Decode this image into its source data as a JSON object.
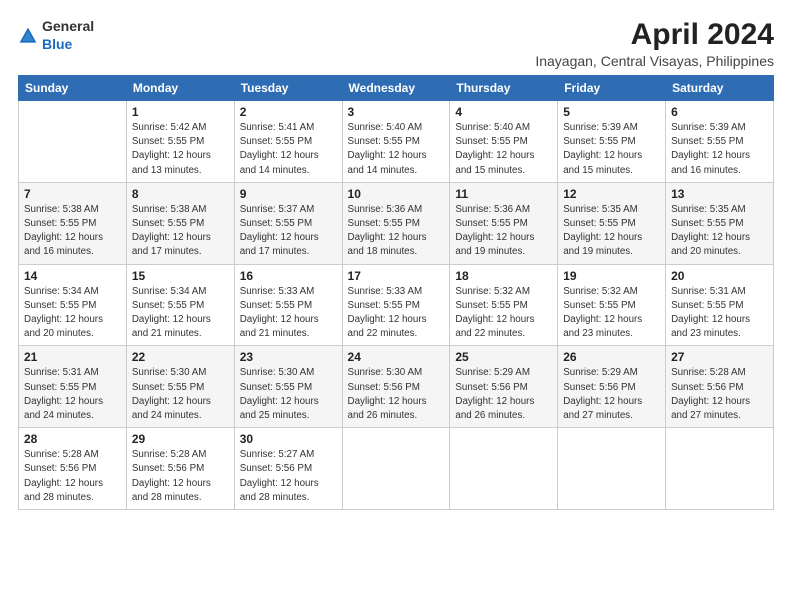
{
  "logo": {
    "general": "General",
    "blue": "Blue"
  },
  "header": {
    "title": "April 2024",
    "subtitle": "Inayagan, Central Visayas, Philippines"
  },
  "columns": [
    "Sunday",
    "Monday",
    "Tuesday",
    "Wednesday",
    "Thursday",
    "Friday",
    "Saturday"
  ],
  "weeks": [
    [
      {
        "day": "",
        "info": ""
      },
      {
        "day": "1",
        "info": "Sunrise: 5:42 AM\nSunset: 5:55 PM\nDaylight: 12 hours\nand 13 minutes."
      },
      {
        "day": "2",
        "info": "Sunrise: 5:41 AM\nSunset: 5:55 PM\nDaylight: 12 hours\nand 14 minutes."
      },
      {
        "day": "3",
        "info": "Sunrise: 5:40 AM\nSunset: 5:55 PM\nDaylight: 12 hours\nand 14 minutes."
      },
      {
        "day": "4",
        "info": "Sunrise: 5:40 AM\nSunset: 5:55 PM\nDaylight: 12 hours\nand 15 minutes."
      },
      {
        "day": "5",
        "info": "Sunrise: 5:39 AM\nSunset: 5:55 PM\nDaylight: 12 hours\nand 15 minutes."
      },
      {
        "day": "6",
        "info": "Sunrise: 5:39 AM\nSunset: 5:55 PM\nDaylight: 12 hours\nand 16 minutes."
      }
    ],
    [
      {
        "day": "7",
        "info": "Sunrise: 5:38 AM\nSunset: 5:55 PM\nDaylight: 12 hours\nand 16 minutes."
      },
      {
        "day": "8",
        "info": "Sunrise: 5:38 AM\nSunset: 5:55 PM\nDaylight: 12 hours\nand 17 minutes."
      },
      {
        "day": "9",
        "info": "Sunrise: 5:37 AM\nSunset: 5:55 PM\nDaylight: 12 hours\nand 17 minutes."
      },
      {
        "day": "10",
        "info": "Sunrise: 5:36 AM\nSunset: 5:55 PM\nDaylight: 12 hours\nand 18 minutes."
      },
      {
        "day": "11",
        "info": "Sunrise: 5:36 AM\nSunset: 5:55 PM\nDaylight: 12 hours\nand 19 minutes."
      },
      {
        "day": "12",
        "info": "Sunrise: 5:35 AM\nSunset: 5:55 PM\nDaylight: 12 hours\nand 19 minutes."
      },
      {
        "day": "13",
        "info": "Sunrise: 5:35 AM\nSunset: 5:55 PM\nDaylight: 12 hours\nand 20 minutes."
      }
    ],
    [
      {
        "day": "14",
        "info": "Sunrise: 5:34 AM\nSunset: 5:55 PM\nDaylight: 12 hours\nand 20 minutes."
      },
      {
        "day": "15",
        "info": "Sunrise: 5:34 AM\nSunset: 5:55 PM\nDaylight: 12 hours\nand 21 minutes."
      },
      {
        "day": "16",
        "info": "Sunrise: 5:33 AM\nSunset: 5:55 PM\nDaylight: 12 hours\nand 21 minutes."
      },
      {
        "day": "17",
        "info": "Sunrise: 5:33 AM\nSunset: 5:55 PM\nDaylight: 12 hours\nand 22 minutes."
      },
      {
        "day": "18",
        "info": "Sunrise: 5:32 AM\nSunset: 5:55 PM\nDaylight: 12 hours\nand 22 minutes."
      },
      {
        "day": "19",
        "info": "Sunrise: 5:32 AM\nSunset: 5:55 PM\nDaylight: 12 hours\nand 23 minutes."
      },
      {
        "day": "20",
        "info": "Sunrise: 5:31 AM\nSunset: 5:55 PM\nDaylight: 12 hours\nand 23 minutes."
      }
    ],
    [
      {
        "day": "21",
        "info": "Sunrise: 5:31 AM\nSunset: 5:55 PM\nDaylight: 12 hours\nand 24 minutes."
      },
      {
        "day": "22",
        "info": "Sunrise: 5:30 AM\nSunset: 5:55 PM\nDaylight: 12 hours\nand 24 minutes."
      },
      {
        "day": "23",
        "info": "Sunrise: 5:30 AM\nSunset: 5:55 PM\nDaylight: 12 hours\nand 25 minutes."
      },
      {
        "day": "24",
        "info": "Sunrise: 5:30 AM\nSunset: 5:56 PM\nDaylight: 12 hours\nand 26 minutes."
      },
      {
        "day": "25",
        "info": "Sunrise: 5:29 AM\nSunset: 5:56 PM\nDaylight: 12 hours\nand 26 minutes."
      },
      {
        "day": "26",
        "info": "Sunrise: 5:29 AM\nSunset: 5:56 PM\nDaylight: 12 hours\nand 27 minutes."
      },
      {
        "day": "27",
        "info": "Sunrise: 5:28 AM\nSunset: 5:56 PM\nDaylight: 12 hours\nand 27 minutes."
      }
    ],
    [
      {
        "day": "28",
        "info": "Sunrise: 5:28 AM\nSunset: 5:56 PM\nDaylight: 12 hours\nand 28 minutes."
      },
      {
        "day": "29",
        "info": "Sunrise: 5:28 AM\nSunset: 5:56 PM\nDaylight: 12 hours\nand 28 minutes."
      },
      {
        "day": "30",
        "info": "Sunrise: 5:27 AM\nSunset: 5:56 PM\nDaylight: 12 hours\nand 28 minutes."
      },
      {
        "day": "",
        "info": ""
      },
      {
        "day": "",
        "info": ""
      },
      {
        "day": "",
        "info": ""
      },
      {
        "day": "",
        "info": ""
      }
    ]
  ]
}
